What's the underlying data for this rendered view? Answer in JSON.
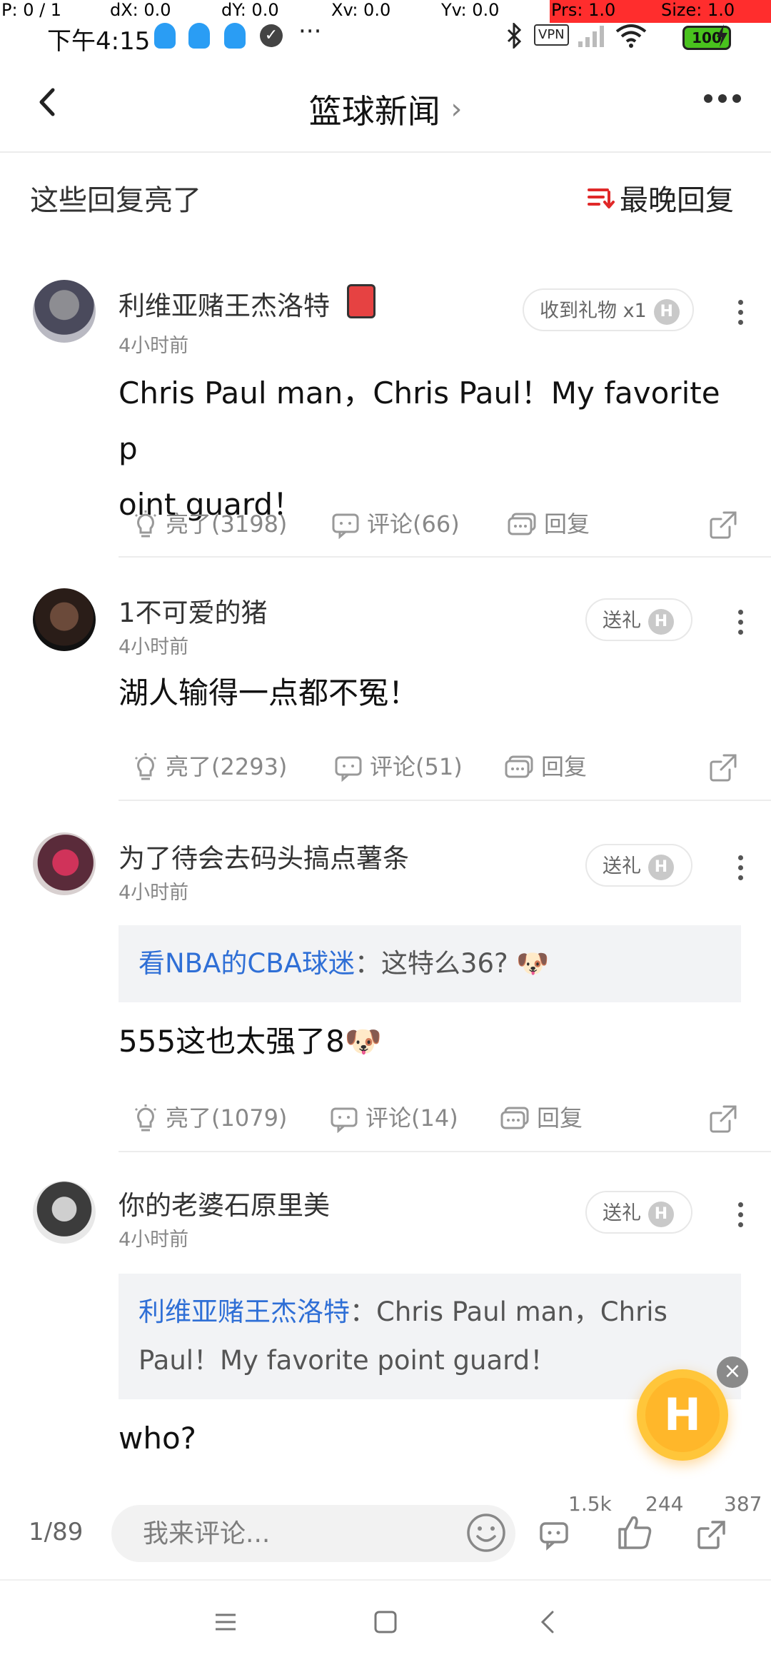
{
  "debug_overlay": {
    "p": "P: 0 / 1",
    "dx": "dX: 0.0",
    "dy": "dY: 0.0",
    "xv": "Xv: 0.0",
    "yv": "Yv: 0.0",
    "prs": "Prs: 1.0",
    "size": "Size: 1.0"
  },
  "status_bar": {
    "time": "下午4:15",
    "more": "···",
    "vpn": "VPN",
    "battery": "100"
  },
  "header": {
    "title": "篮球新闻",
    "chevron": "›"
  },
  "section": {
    "title": "这些回复亮了",
    "sort_label": "最晚回复"
  },
  "comments": [
    {
      "username": "利维亚赌王杰洛特",
      "time": "4小时前",
      "gift_label": "收到礼物 x1",
      "text": "Chris Paul man，Chris Paul！My favorite point guard！",
      "text_line1": "Chris Paul man，Chris Paul！My favorite p",
      "text_line2": "oint guard！",
      "likes": "亮了(3198)",
      "comments": "评论(66)",
      "reply": "回复"
    },
    {
      "username": "1不可爱的猪",
      "time": "4小时前",
      "gift_label": "送礼",
      "text": "湖人输得一点都不冤！",
      "likes": "亮了(2293)",
      "comments": "评论(51)",
      "reply": "回复"
    },
    {
      "username": "为了待会去码头搞点薯条",
      "time": "4小时前",
      "gift_label": "送礼",
      "quote_name": "看NBA的CBA球迷",
      "quote_text": "：这特么36? 🐶",
      "text": "555这也太强了8🐶",
      "likes": "亮了(1079)",
      "comments": "评论(14)",
      "reply": "回复"
    },
    {
      "username": "你的老婆石原里美",
      "time": "4小时前",
      "gift_label": "送礼",
      "quote_name": "利维亚赌王杰洛特",
      "quote_text": "：Chris Paul man，Chris Paul！My favorite point guard！",
      "text": "who?"
    }
  ],
  "floating_button": {
    "label": "H",
    "close": "×"
  },
  "bottom_bar": {
    "pager": "1/89",
    "input_placeholder": "我来评论...",
    "comment_count": "1.5k",
    "like_count": "244",
    "share_count": "387"
  },
  "colors": {
    "link_blue": "#2f6fd6",
    "sort_red": "#e02828",
    "fab_yellow": "#ffb72a",
    "battery_green": "#49c21d",
    "qq_blue": "#2a9df4"
  }
}
